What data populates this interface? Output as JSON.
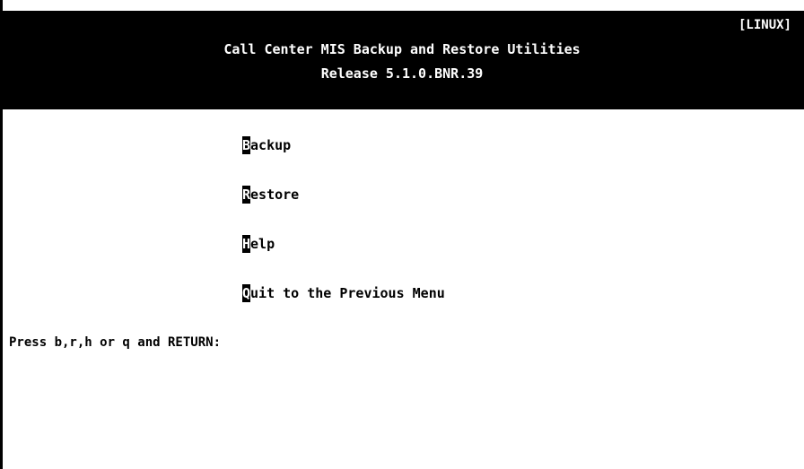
{
  "header": {
    "platform_tag": "[LINUX]",
    "title": "Call Center MIS Backup and Restore Utilities",
    "release": "Release 5.1.0.BNR.39"
  },
  "menu": {
    "items": [
      {
        "hotkey": "B",
        "rest": "ackup"
      },
      {
        "hotkey": "R",
        "rest": "estore"
      },
      {
        "hotkey": "H",
        "rest": "elp"
      },
      {
        "hotkey": "Q",
        "rest": "uit to the Previous Menu"
      }
    ]
  },
  "prompt": {
    "text": "Press b,r,h or q and RETURN:"
  },
  "colors": {
    "background": "#ffffff",
    "header_background": "#000000",
    "text": "#000000",
    "header_text": "#ffffff"
  }
}
